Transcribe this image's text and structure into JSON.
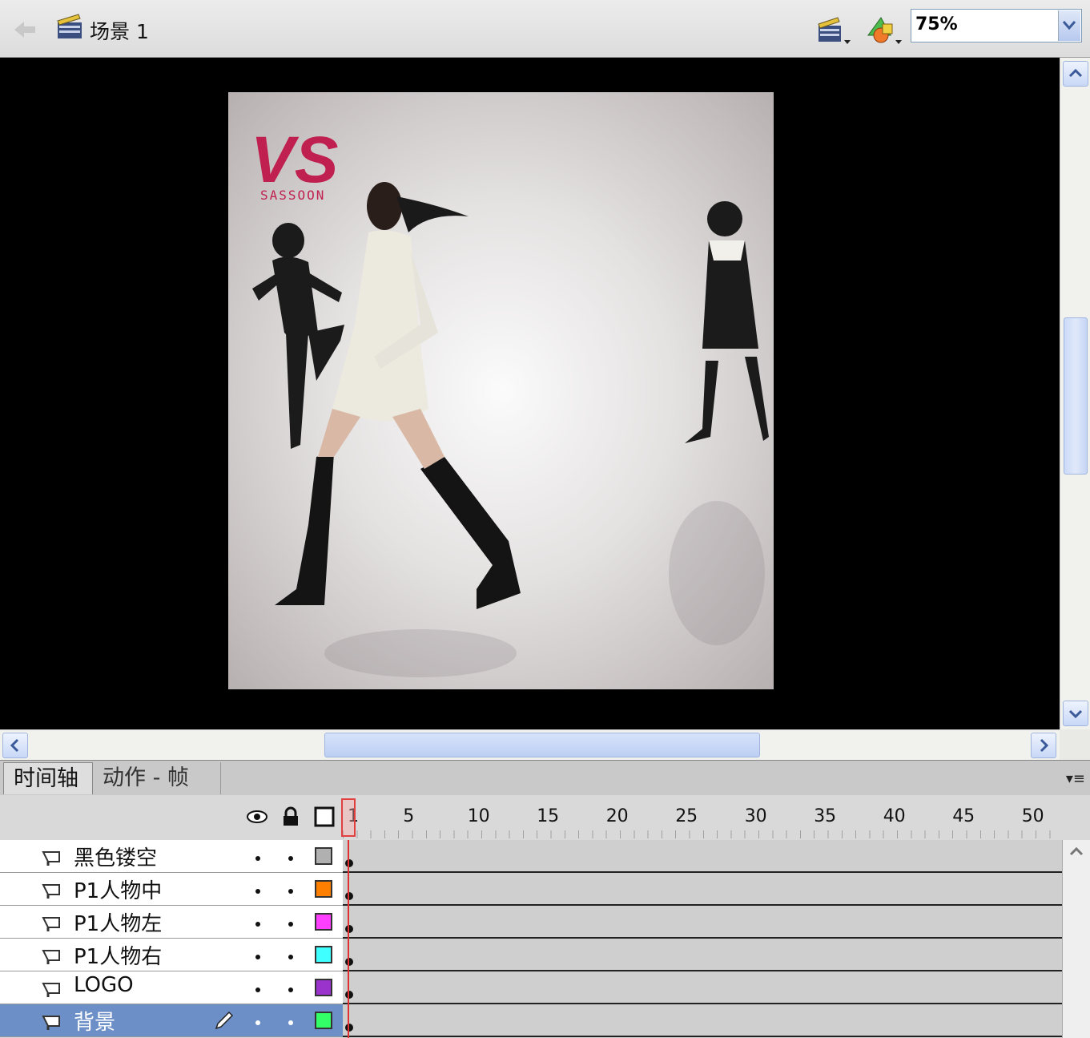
{
  "editbar": {
    "scene_label": "场景 1",
    "zoom_value": "75%"
  },
  "stage": {
    "brand_mark": "VS",
    "brand_sub": "SASSOON",
    "brand_color": "#c0204f"
  },
  "panel": {
    "tabs": [
      "时间轴",
      "动作 - 帧"
    ],
    "menu_icon": "▾≡"
  },
  "timeline": {
    "ruler": [
      "1",
      "5",
      "10",
      "15",
      "20",
      "25",
      "30",
      "35",
      "40",
      "45",
      "50"
    ],
    "current_frame": 1,
    "layers": [
      {
        "name": "黑色镂空",
        "outline_color": "#b0b0b0",
        "selected": false
      },
      {
        "name": "P1人物中",
        "outline_color": "#ff7f00",
        "selected": false
      },
      {
        "name": "P1人物左",
        "outline_color": "#ff3fff",
        "selected": false
      },
      {
        "name": "P1人物右",
        "outline_color": "#3fffff",
        "selected": false
      },
      {
        "name": "LOGO",
        "outline_color": "#9933cc",
        "selected": false
      },
      {
        "name": "背景",
        "outline_color": "#33ff66",
        "selected": true
      }
    ]
  }
}
